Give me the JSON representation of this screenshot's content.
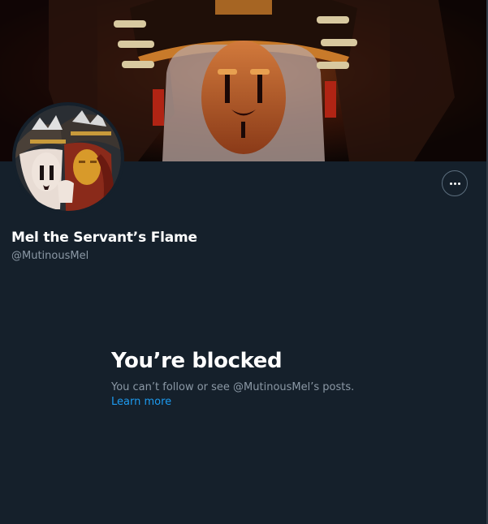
{
  "profile": {
    "display_name": "Mel the Servant’s Flame",
    "handle": "@MutinousMel"
  },
  "blocked": {
    "title": "You’re blocked",
    "message": "You can’t follow or see @MutinousMel’s posts.",
    "learn_more": "Learn more"
  },
  "icons": {
    "more": "more-options-icon"
  },
  "colors": {
    "background": "#15202b",
    "primary_text": "#ffffff",
    "secondary_text": "#8b98a5",
    "link": "#1d9bf0"
  }
}
